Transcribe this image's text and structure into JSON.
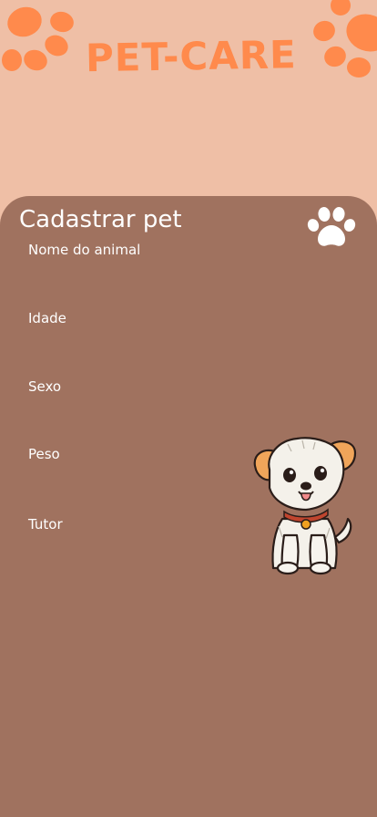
{
  "app": {
    "brand_title": "PET-CARE"
  },
  "form": {
    "title": "Cadastrar pet",
    "fields": [
      {
        "label": "Nome do animal"
      },
      {
        "label": "Idade"
      },
      {
        "label": "Sexo"
      },
      {
        "label": "Peso"
      },
      {
        "label": "Tutor"
      }
    ]
  },
  "icons": {
    "paw_decor": "paw-icon",
    "title_paw": "paw-icon",
    "mascot": "puppy-illustration"
  },
  "colors": {
    "header_background": "#efbfa6",
    "card_background": "#a0725f",
    "brand_accent": "#ff8a4c",
    "text": "#ffffff"
  }
}
